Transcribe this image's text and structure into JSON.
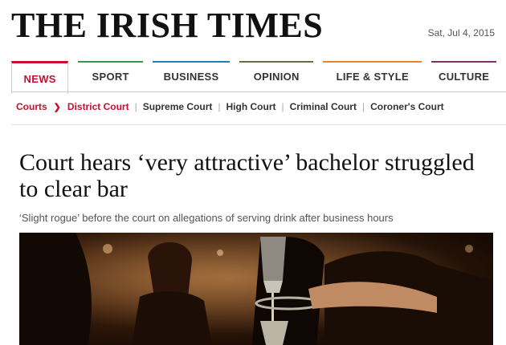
{
  "header": {
    "logo": "THE IRISH TIMES",
    "date": "Sat, Jul 4, 2015"
  },
  "nav": {
    "tabs": [
      {
        "label": "NEWS",
        "active": true,
        "color": "#c8102e"
      },
      {
        "label": "SPORT",
        "color": "#2e9c4a"
      },
      {
        "label": "BUSINESS",
        "color": "#1f7fb8"
      },
      {
        "label": "OPINION",
        "color": "#6b6b48"
      },
      {
        "label": "LIFE & STYLE",
        "color": "#e8842a"
      },
      {
        "label": "CULTURE",
        "color": "#8a2b6f"
      }
    ]
  },
  "subnav": {
    "section": "Courts",
    "current": "District Court",
    "links": [
      "Supreme Court",
      "High Court",
      "Criminal Court",
      "Coroner's Court"
    ]
  },
  "article": {
    "headline": "Court hears ‘very attractive’ bachelor struggled to clear bar",
    "standfirst": "‘Slight rogue’ before the court on allegations of serving drink after business hours"
  },
  "colors": {
    "accent": "#c8102e"
  }
}
